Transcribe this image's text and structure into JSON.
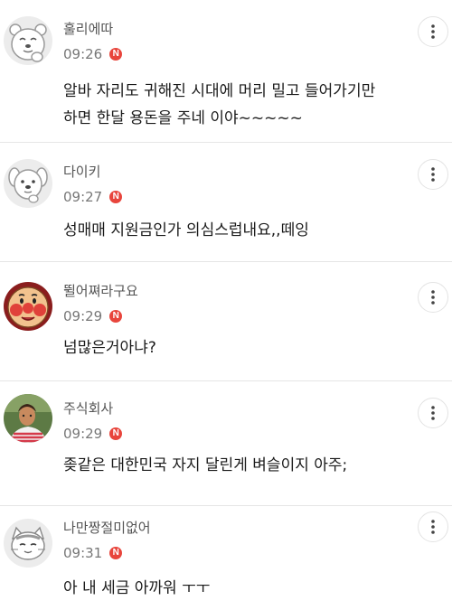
{
  "comments": [
    {
      "username": "훌리에따",
      "time": "09:26",
      "badge": "N",
      "text": "알바 자리도 귀해진 시대에 머리 밀고 들어가기만\n하면 한달 용돈을 주네 이야~~~~~",
      "avatar_icon": "cartoon-bear-avatar-icon"
    },
    {
      "username": "다이키",
      "time": "09:27",
      "badge": "N",
      "text": "성매매 지원금인가 의심스럽내요,,떼잉",
      "avatar_icon": "cartoon-dog-avatar-icon"
    },
    {
      "username": "뛸어쪄라구요",
      "time": "09:29",
      "badge": "N",
      "text": "넘많은거아냐?",
      "avatar_icon": "anpanman-avatar-icon"
    },
    {
      "username": "주식회사",
      "time": "09:29",
      "badge": "N",
      "text": "좆같은 대한민국 자지 달린게 벼슬이지 아주;",
      "avatar_icon": "person-photo-avatar-icon"
    },
    {
      "username": "나만짱절미없어",
      "time": "09:31",
      "badge": "N",
      "text": "아 내 세금 아까워 ㅜㅜ",
      "avatar_icon": "cartoon-cat-avatar-icon"
    }
  ],
  "colors": {
    "badge": "#e8453c",
    "divider": "#e6e6e6",
    "username": "#555555",
    "time": "#777777",
    "text": "#1a1a1a"
  }
}
